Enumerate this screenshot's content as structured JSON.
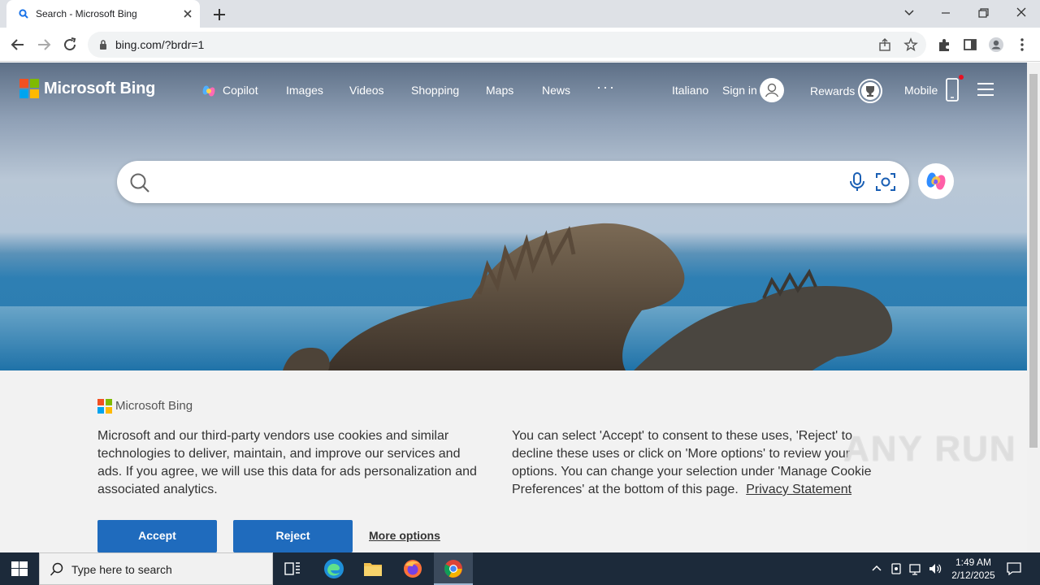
{
  "browser": {
    "tab_title": "Search - Microsoft Bing",
    "url": "bing.com/?brdr=1"
  },
  "bing": {
    "brand": "Microsoft Bing",
    "nav": [
      "Copilot",
      "Images",
      "Videos",
      "Shopping",
      "Maps",
      "News",
      "···"
    ],
    "language": "Italiano",
    "sign_in": "Sign in",
    "rewards": "Rewards",
    "mobile": "Mobile",
    "search_placeholder": ""
  },
  "cookie": {
    "brand": "Microsoft Bing",
    "left_lines": [
      "Microsoft and our third-party vendors use cookies and similar",
      "technologies to deliver, maintain, and improve our services and",
      "ads. If you agree, we will use this data for ads personalization and",
      "associated analytics."
    ],
    "right_lines": [
      "You can select 'Accept' to consent to these uses, 'Reject' to",
      "decline these uses or click on 'More options' to review your",
      "options. You can change your selection under 'Manage Cookie",
      "Preferences' at the bottom of this page."
    ],
    "privacy_link": "Privacy Statement",
    "accept": "Accept",
    "reject": "Reject",
    "more_options": "More options"
  },
  "watermark": "ANY RUN",
  "taskbar": {
    "search_placeholder": "Type here to search",
    "time": "1:49 AM",
    "date": "2/12/2025"
  },
  "colors": {
    "accent_blue": "#1f6bbd",
    "ms_red": "#f25022",
    "ms_green": "#7fba00",
    "ms_blue": "#00a4ef",
    "ms_yellow": "#ffb900"
  }
}
